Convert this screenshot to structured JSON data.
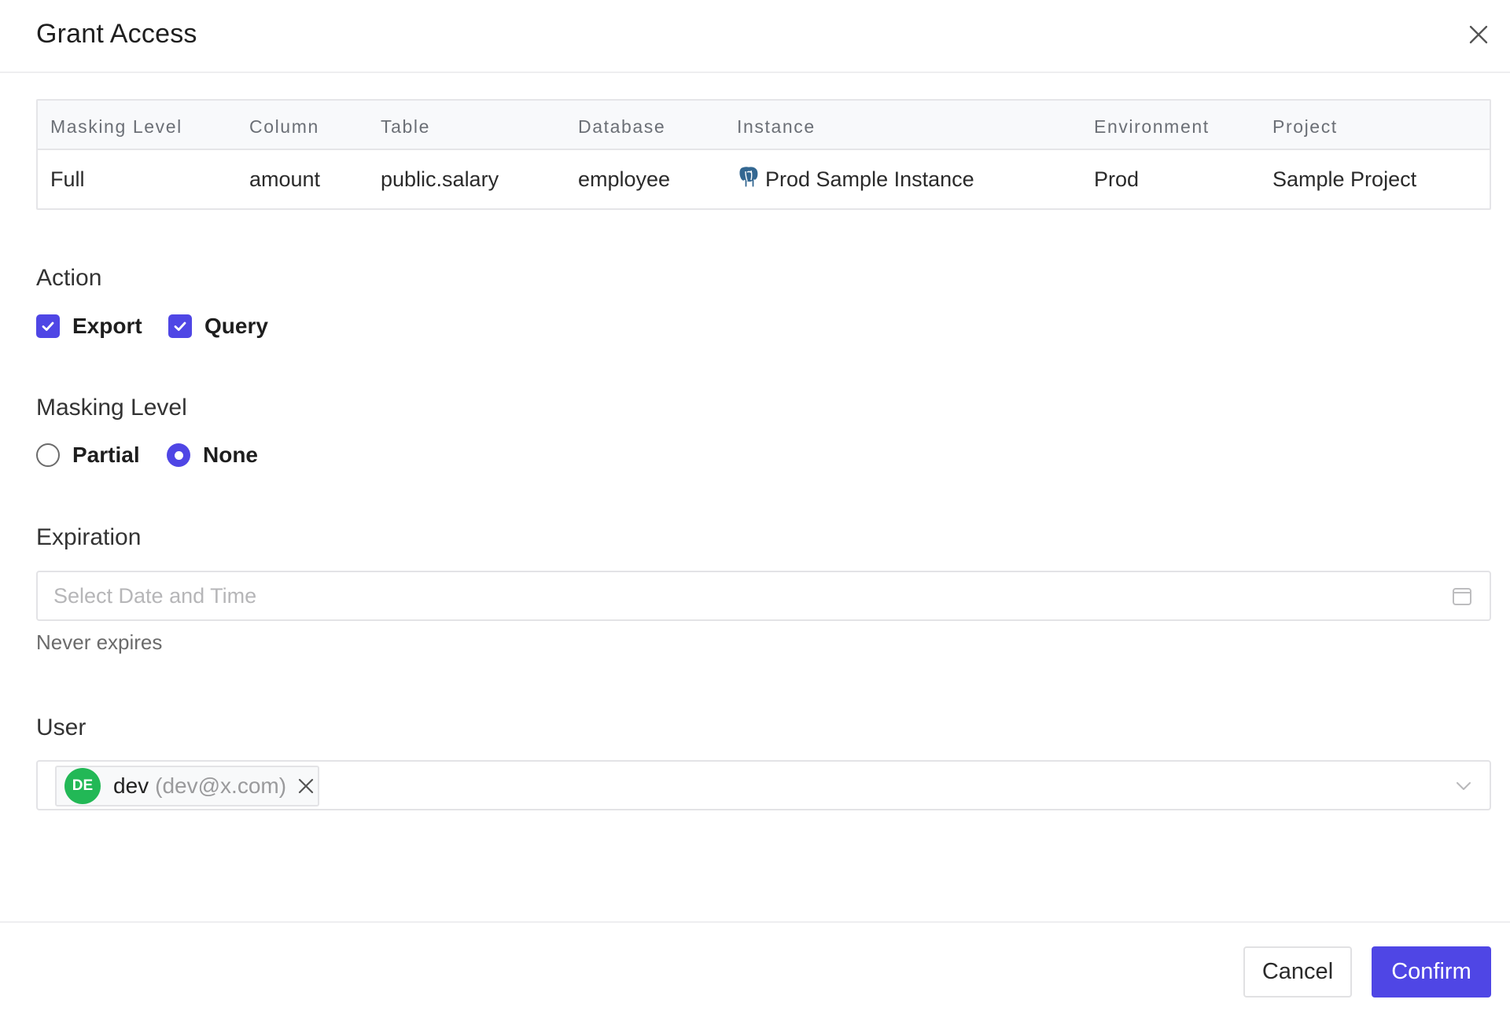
{
  "dialog": {
    "title": "Grant Access",
    "close_icon": "close-icon"
  },
  "table": {
    "columns": [
      "Masking Level",
      "Column",
      "Table",
      "Database",
      "Instance",
      "Environment",
      "Project"
    ],
    "rows": [
      {
        "masking_level": "Full",
        "column": "amount",
        "table": "public.salary",
        "database": "employee",
        "instance": "Prod Sample Instance",
        "instance_icon": "postgresql-icon",
        "environment": "Prod",
        "project": "Sample Project"
      }
    ]
  },
  "action": {
    "label": "Action",
    "options": [
      {
        "label": "Export",
        "checked": true
      },
      {
        "label": "Query",
        "checked": true
      }
    ]
  },
  "masking_level": {
    "label": "Masking Level",
    "options": [
      {
        "label": "Partial",
        "selected": false
      },
      {
        "label": "None",
        "selected": true
      }
    ]
  },
  "expiration": {
    "label": "Expiration",
    "placeholder": "Select Date and Time",
    "value": "",
    "hint": "Never expires",
    "icon": "calendar-icon"
  },
  "user": {
    "label": "User",
    "selected": [
      {
        "initials": "DE",
        "name": "dev",
        "email": "(dev@x.com)",
        "avatar_color": "#22b856"
      }
    ],
    "icon": "chevron-down-icon"
  },
  "footer": {
    "cancel_label": "Cancel",
    "confirm_label": "Confirm"
  },
  "colors": {
    "accent": "#4f46e5",
    "avatar": "#22b856"
  }
}
